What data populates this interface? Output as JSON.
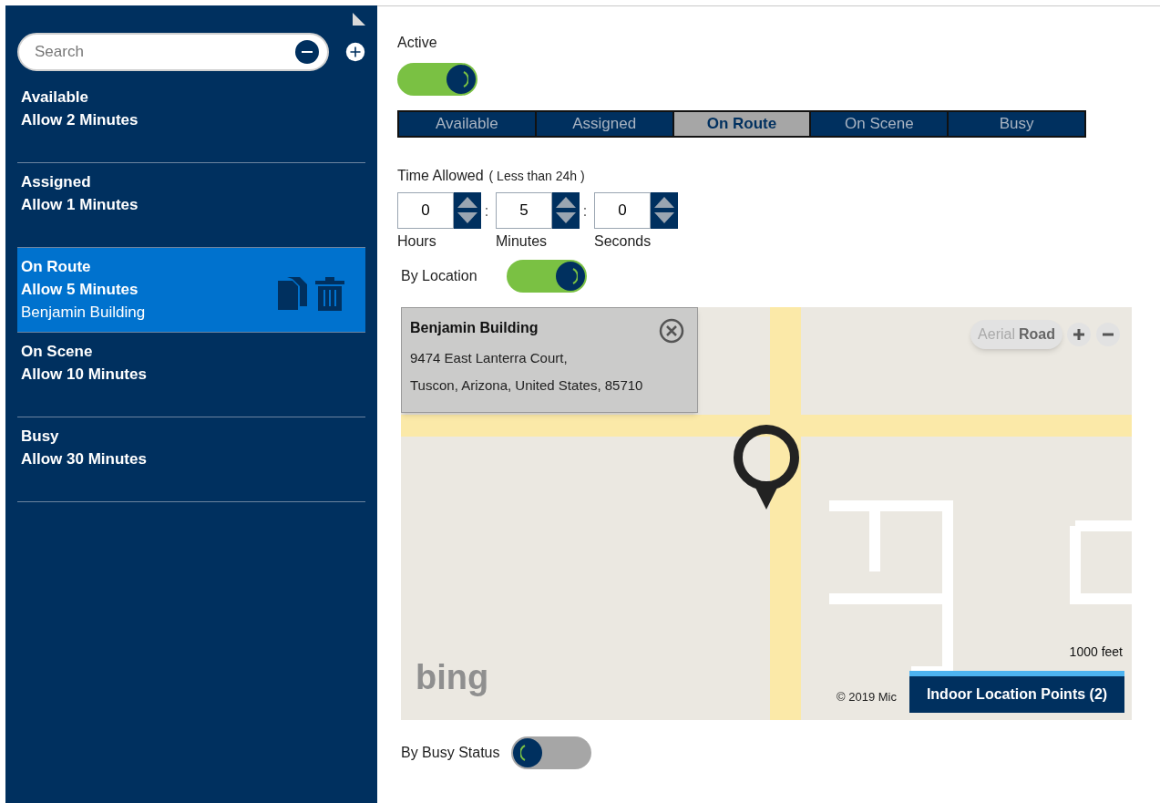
{
  "sidebar": {
    "search": {
      "placeholder": "Search"
    },
    "items": [
      {
        "name": "Available",
        "allowance": "Allow 2 Minutes",
        "selected": false
      },
      {
        "name": "Assigned",
        "allowance": "Allow 1 Minutes",
        "selected": false
      },
      {
        "name": "On Route",
        "allowance": "Allow 5 Minutes",
        "location": "Benjamin Building",
        "selected": true
      },
      {
        "name": "On Scene",
        "allowance": "Allow 10 Minutes",
        "selected": false
      },
      {
        "name": "Busy",
        "allowance": "Allow 30 Minutes",
        "selected": false
      }
    ]
  },
  "active": {
    "label": "Active",
    "on": true
  },
  "status_tabs": [
    {
      "label": "Available",
      "selected": false
    },
    {
      "label": "Assigned",
      "selected": false
    },
    {
      "label": "On Route",
      "selected": true
    },
    {
      "label": "On Scene",
      "selected": false
    },
    {
      "label": "Busy",
      "selected": false
    }
  ],
  "time_allowed": {
    "label": "Time Allowed",
    "hint": "( Less than 24h )",
    "separator": ":",
    "fields": [
      {
        "value": "0",
        "label": "Hours"
      },
      {
        "value": "5",
        "label": "Minutes"
      },
      {
        "value": "0",
        "label": "Seconds"
      }
    ]
  },
  "by_location": {
    "label": "By Location",
    "on": true
  },
  "map": {
    "popup": {
      "title": "Benjamin Building",
      "address_lines": [
        "9474 East Lanterra Court,",
        "Tuscon, Arizona, United States, 85710"
      ]
    },
    "view_modes": [
      {
        "label": "Aerial",
        "selected": false
      },
      {
        "label": "Road",
        "selected": true
      }
    ],
    "scale": "1000 feet",
    "logo": "bing",
    "copyright": "© 2019 Mic",
    "indoor_button": "Indoor Location Points (2)"
  },
  "by_busy_status": {
    "label": "By Busy Status",
    "on": false
  }
}
